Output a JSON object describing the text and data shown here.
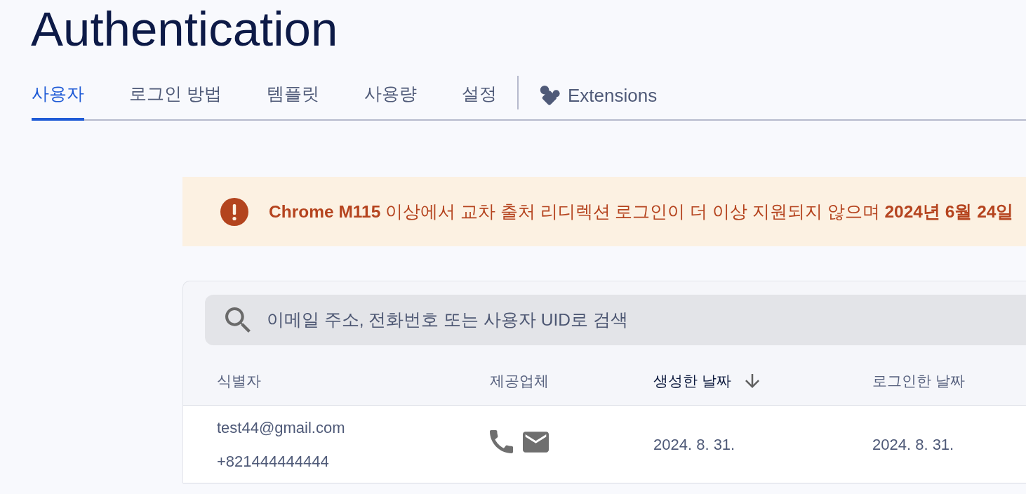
{
  "page": {
    "title": "Authentication"
  },
  "tabs": [
    {
      "label": "사용자",
      "selected": true
    },
    {
      "label": "로그인 방법",
      "selected": false
    },
    {
      "label": "템플릿",
      "selected": false
    },
    {
      "label": "사용량",
      "selected": false
    },
    {
      "label": "설정",
      "selected": false
    }
  ],
  "extensions_tab": {
    "label": "Extensions"
  },
  "banner": {
    "text": "**Chrome M115** 이상에서 교차 출처 리디렉션 로그인이 더 이상 지원되지 않으며 **2024년 6월 24일**"
  },
  "users_table": {
    "search": {
      "placeholder": "이메일 주소, 전화번호 또는 사용자 UID로 검색"
    },
    "columns": [
      {
        "label": "식별자",
        "sorted": false
      },
      {
        "label": "제공업체",
        "sorted": false
      },
      {
        "label": "생성한 날짜",
        "sorted": true
      },
      {
        "label": "로그인한 날짜",
        "sorted": false
      }
    ],
    "rows": [
      {
        "identifier": [
          "test44@gmail.com",
          "+821444444444"
        ],
        "providers": [
          {
            "kind": "phone"
          },
          {
            "kind": "email"
          }
        ],
        "created": "2024. 8. 31.",
        "signed_in": "2024. 8. 31."
      }
    ]
  }
}
